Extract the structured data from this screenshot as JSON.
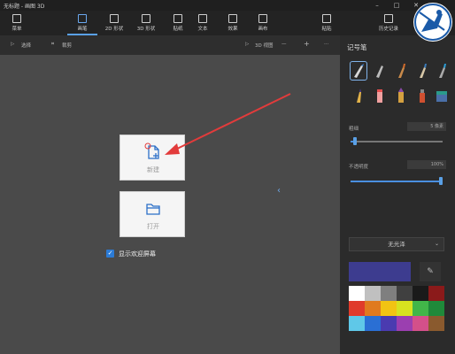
{
  "window": {
    "title": "无标题 - 画图 3D",
    "minimize": "–",
    "maximize": "□",
    "close": "✕"
  },
  "ribbon": {
    "menu_label": "菜单",
    "tabs": [
      {
        "id": "brushes",
        "label": "画笔"
      },
      {
        "id": "shapes2d",
        "label": "2D 形状"
      },
      {
        "id": "shapes3d",
        "label": "3D 形状"
      },
      {
        "id": "stickers",
        "label": "贴纸"
      },
      {
        "id": "text",
        "label": "文本"
      },
      {
        "id": "effects",
        "label": "效果"
      },
      {
        "id": "canvas",
        "label": "画布"
      }
    ],
    "paste_label": "粘贴",
    "history_label": "历史记录"
  },
  "subbar": {
    "select": "选择",
    "crop": "裁剪",
    "view3d": "3D 视图",
    "zoom_out": "—",
    "zoom_in": "+",
    "more": "···"
  },
  "welcome": {
    "new_label": "新建",
    "open_label": "打开",
    "show_welcome_label": "显示欢迎屏幕",
    "show_welcome_checked": true
  },
  "panel": {
    "title": "记号笔",
    "thickness_label": "粗细",
    "thickness_value": "5 像素",
    "thickness_level": 0.05,
    "opacity_label": "不透明度",
    "opacity_value": "100%",
    "opacity_level": 1.0,
    "finish_select": "无光泽",
    "eyedropper_icon": "eyedropper-icon",
    "current_color": "#3d3c8f",
    "swatches": [
      "#ffffff",
      "#c0c0c0",
      "#7f7f7f",
      "#404040",
      "#1a1a1a",
      "#8b1a1a",
      "#e03b2b",
      "#e07a1f",
      "#f2c313",
      "#d7e21f",
      "#41b649",
      "#1f8a3a",
      "#5fc8e8",
      "#2a6fd4",
      "#4a3bb0",
      "#9b3fb0",
      "#d4508a",
      "#8a5a2e"
    ]
  },
  "colors": {
    "accent": "#5aa0e6",
    "arrow": "#e23b3b"
  }
}
